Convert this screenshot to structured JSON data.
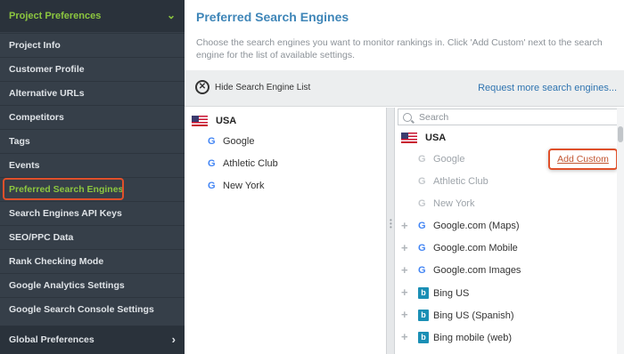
{
  "sidebar": {
    "header": "Project Preferences",
    "items": [
      {
        "label": "Project Info"
      },
      {
        "label": "Customer Profile"
      },
      {
        "label": "Alternative URLs"
      },
      {
        "label": "Competitors"
      },
      {
        "label": "Tags"
      },
      {
        "label": "Events"
      },
      {
        "label": "Preferred Search Engines",
        "active": true
      },
      {
        "label": "Search Engines API Keys"
      },
      {
        "label": "SEO/PPC Data"
      },
      {
        "label": "Rank Checking Mode"
      },
      {
        "label": "Google Analytics Settings"
      },
      {
        "label": "Google Search Console Settings"
      }
    ],
    "footer": "Global Preferences"
  },
  "main": {
    "title": "Preferred Search Engines",
    "description": "Choose the search engines you want to monitor rankings in. Click 'Add Custom' next to the search engine for the list of available settings.",
    "hide_list_label": "Hide Search Engine List",
    "request_link": "Request more search engines..."
  },
  "selected": {
    "country": "USA",
    "engines": [
      "Google",
      "Athletic Club",
      "New York"
    ]
  },
  "available": {
    "search_placeholder": "Search",
    "country": "USA",
    "add_custom_label": "Add Custom",
    "selected_engines": [
      "Google",
      "Athletic Club",
      "New York"
    ],
    "engines": [
      {
        "label": "Google.com (Maps)",
        "icon": "google-icon"
      },
      {
        "label": "Google.com Mobile",
        "icon": "google-icon"
      },
      {
        "label": "Google.com Images",
        "icon": "google-icon"
      },
      {
        "label": "Bing US",
        "icon": "bing-icon"
      },
      {
        "label": "Bing US (Spanish)",
        "icon": "bing-icon"
      },
      {
        "label": "Bing mobile (web)",
        "icon": "bing-icon"
      }
    ]
  },
  "icons": {
    "google_glyph": "G",
    "bing_glyph": "b",
    "plus_glyph": "+",
    "chevron_down": "⌄",
    "chevron_right": "›",
    "close_glyph": "✕"
  },
  "colors": {
    "sidebar_bg": "#363f49",
    "accent_green": "#8cc63f",
    "highlight_orange": "#e0502a",
    "title_blue": "#3f86b8",
    "link_blue": "#2f74b0",
    "bing_teal": "#1a8fb5"
  }
}
